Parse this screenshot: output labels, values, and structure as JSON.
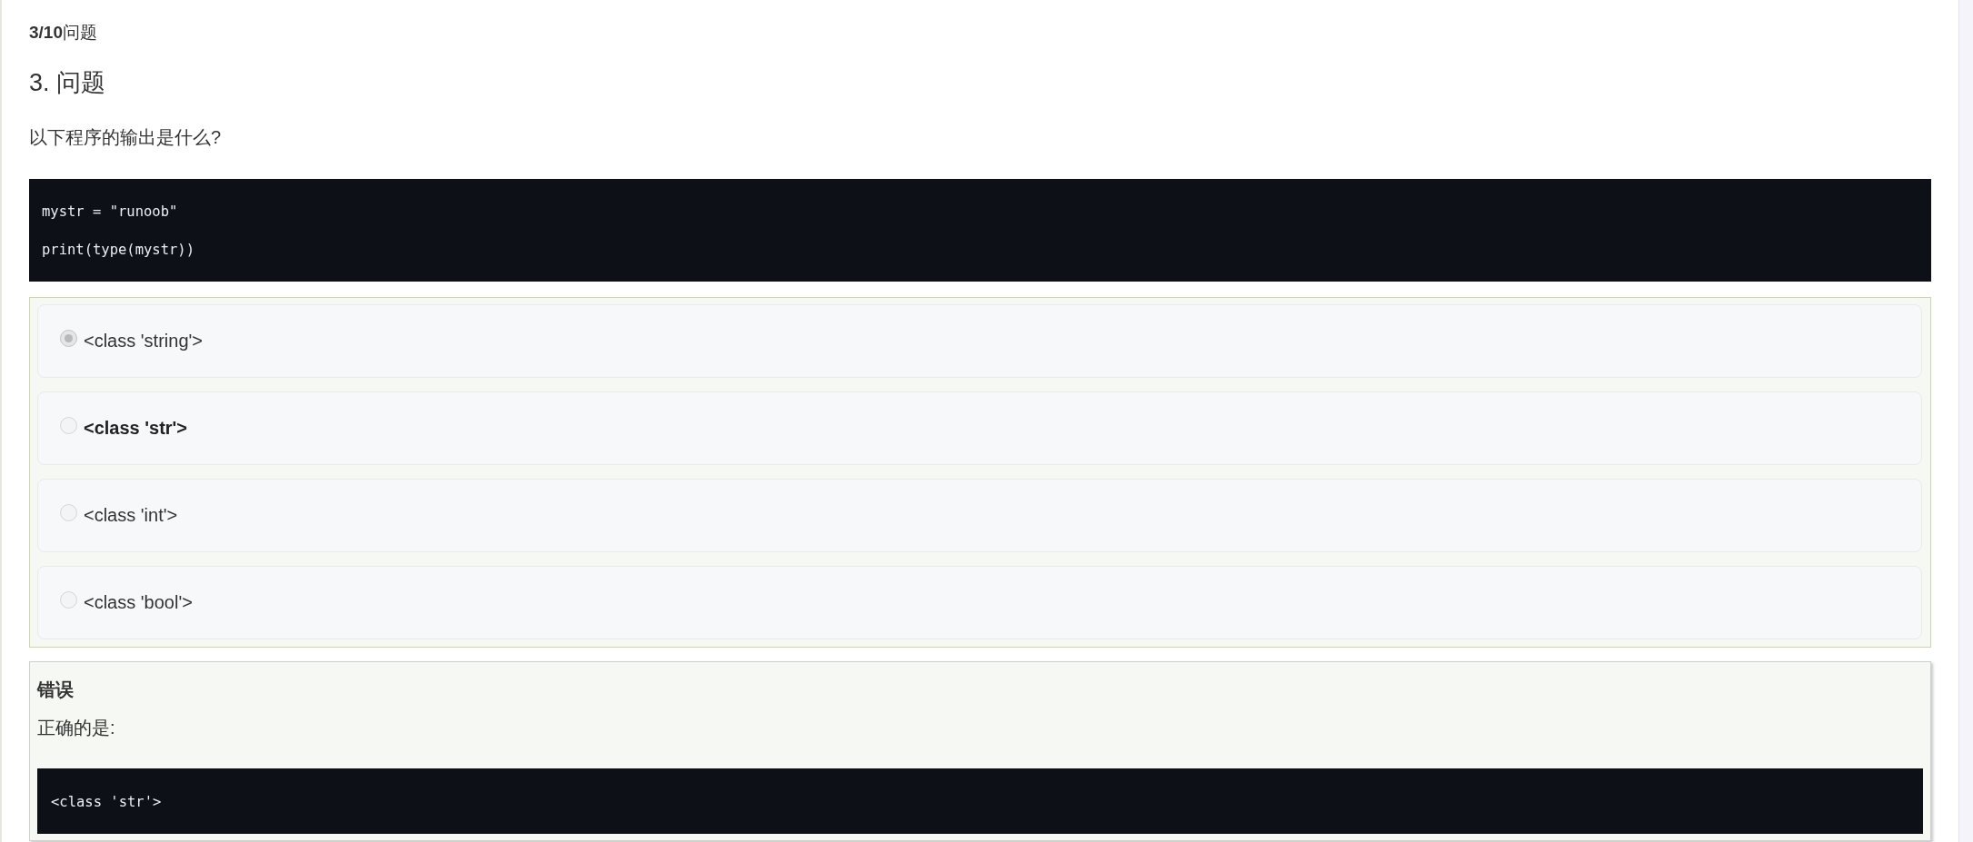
{
  "progress": {
    "text": "**3/10**问题"
  },
  "question": {
    "title": "3. 问题",
    "prompt": "以下程序的输出是什么?",
    "code": [
      "mystr = \"runoob\"",
      "print(type(mystr))"
    ]
  },
  "options": [
    {
      "label": "<class 'string'>",
      "selected": true,
      "correct": false,
      "disabled": true
    },
    {
      "label": "<class 'str'>",
      "selected": false,
      "correct": true,
      "disabled": true
    },
    {
      "label": "<class 'int'>",
      "selected": false,
      "correct": false,
      "disabled": true
    },
    {
      "label": "<class 'bool'>",
      "selected": false,
      "correct": false,
      "disabled": true
    }
  ],
  "feedback": {
    "verdict": "错误",
    "explanation": "正确的是:",
    "code": [
      "<class 'str'>"
    ]
  }
}
